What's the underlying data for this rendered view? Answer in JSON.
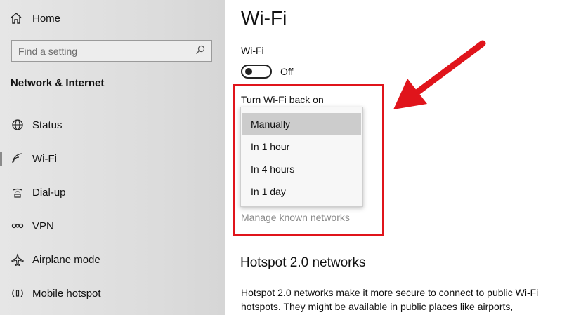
{
  "sidebar": {
    "home_label": "Home",
    "search_placeholder": "Find a setting",
    "section_title": "Network & Internet",
    "items": [
      {
        "label": "Status",
        "icon": "globe-icon"
      },
      {
        "label": "Wi-Fi",
        "icon": "wifi-icon"
      },
      {
        "label": "Dial-up",
        "icon": "dialup-icon"
      },
      {
        "label": "VPN",
        "icon": "vpn-icon"
      },
      {
        "label": "Airplane mode",
        "icon": "airplane-icon"
      },
      {
        "label": "Mobile hotspot",
        "icon": "hotspot-icon"
      }
    ],
    "active_item": "Wi-Fi"
  },
  "main": {
    "title": "Wi-Fi",
    "wifi_label": "Wi-Fi",
    "toggle_state": "Off",
    "toggle_on": false,
    "turn_back_label": "Turn Wi-Fi back on",
    "dropdown_options": [
      "Manually",
      "In 1 hour",
      "In 4 hours",
      "In 1 day"
    ],
    "dropdown_selected": "Manually",
    "manage_link": "Manage known networks",
    "hotspot_heading": "Hotspot 2.0 networks",
    "hotspot_desc": "Hotspot 2.0 networks make it more secure to connect to public Wi-Fi hotspots. They might be available in public places like airports,"
  },
  "annotation": {
    "color": "#e0141b"
  }
}
